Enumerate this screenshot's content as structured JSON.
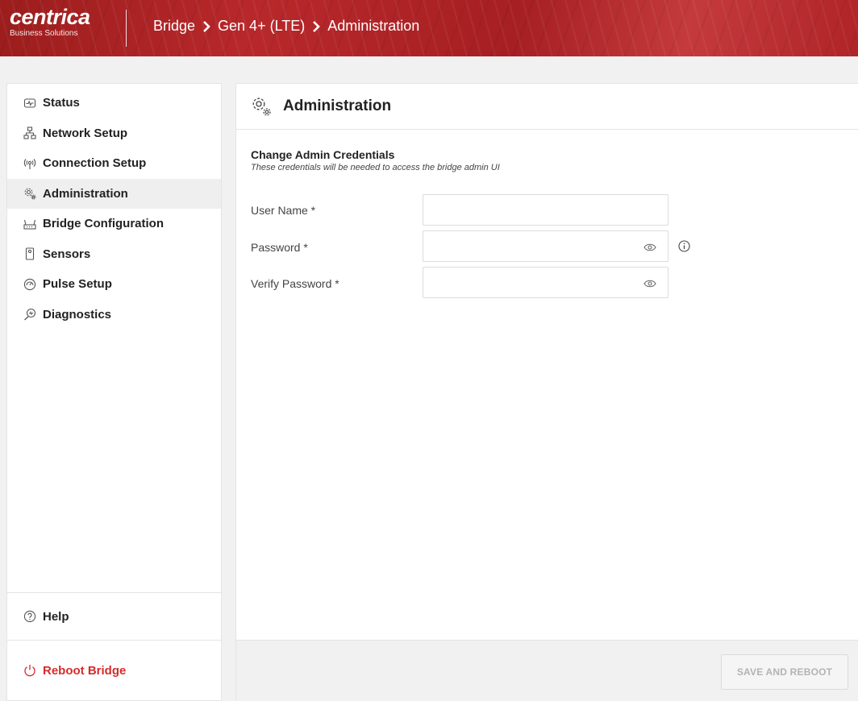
{
  "header": {
    "logo_word": "centrica",
    "logo_sub": "Business Solutions",
    "breadcrumb": [
      "Bridge",
      "Gen 4+ (LTE)",
      "Administration"
    ]
  },
  "sidebar": {
    "items": [
      {
        "label": "Status",
        "icon": "status-icon"
      },
      {
        "label": "Network Setup",
        "icon": "network-icon"
      },
      {
        "label": "Connection Setup",
        "icon": "antenna-icon"
      },
      {
        "label": "Administration",
        "icon": "gears-icon",
        "active": true
      },
      {
        "label": "Bridge Configuration",
        "icon": "router-icon"
      },
      {
        "label": "Sensors",
        "icon": "sensor-icon"
      },
      {
        "label": "Pulse Setup",
        "icon": "gauge-icon"
      },
      {
        "label": "Diagnostics",
        "icon": "magnifier-icon"
      }
    ],
    "help_label": "Help",
    "reboot_label": "Reboot Bridge"
  },
  "main": {
    "title": "Administration",
    "section_title": "Change Admin Credentials",
    "section_subtitle": "These credentials will be needed to access the bridge admin UI",
    "fields": {
      "username_label": "User Name *",
      "username_value": "",
      "password_label": "Password *",
      "password_value": "",
      "verify_label": "Verify Password *",
      "verify_value": ""
    },
    "save_button": "SAVE AND REBOOT"
  },
  "colors": {
    "brand_red": "#b8282b",
    "reboot_red": "#d62b2b",
    "disabled_text": "#b3b3b3"
  }
}
